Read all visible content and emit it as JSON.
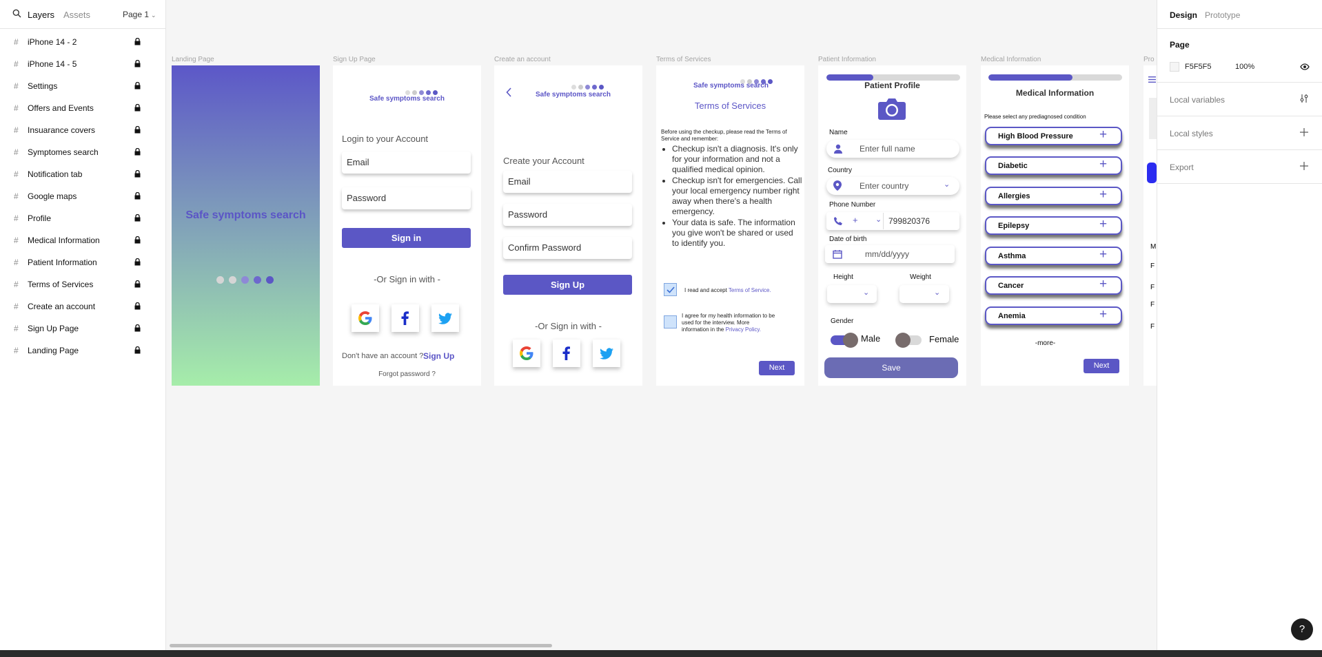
{
  "left_panel": {
    "tabs": [
      "Layers",
      "Assets"
    ],
    "page_selector": "Page 1",
    "layers": [
      "iPhone 14 - 2",
      "iPhone 14 - 5",
      "Settings",
      "Offers and Events",
      "Insuarance covers",
      "Symptomes search",
      "Notification tab",
      "Google maps",
      "Profile",
      "Medical Information",
      "Patient Information",
      "Terms of Services",
      "Create an account",
      "Sign Up Page",
      "Landing Page"
    ]
  },
  "right_panel": {
    "tabs": [
      "Design",
      "Prototype"
    ],
    "page_title": "Page",
    "page_color": "F5F5F5",
    "page_opacity": "100%",
    "local_variables": "Local variables",
    "local_styles": "Local styles",
    "export": "Export",
    "help": "?"
  },
  "canvas": {
    "frame_labels": [
      "Landing Page",
      "Sign Up Page",
      "Create an account",
      "Terms of Services",
      "Patient Information",
      "Medical Information",
      "Pro"
    ],
    "brand": "Safe symptoms search",
    "landing": {
      "title": "Safe symptoms search"
    },
    "signup": {
      "heading": "Login to your Account",
      "email": "Email",
      "password": "Password",
      "sign_in": "Sign in",
      "or_sign_in": "-Or Sign in with -",
      "no_account": "Don't have an account ?",
      "sign_up_link": "Sign Up",
      "forgot": "Forgot password ?"
    },
    "create": {
      "heading": "Create your Account",
      "email": "Email",
      "password": "Password",
      "confirm": "Confirm Password",
      "sign_up": "Sign Up",
      "or_sign_in": "-Or Sign in with -"
    },
    "terms": {
      "title": "Terms of Services",
      "intro": "Before using the checkup, please read the Terms of Service and remember:",
      "items": [
        "Checkup isn't a diagnosis. It's only for your information and not a qualified medical opinion.",
        "Checkup isn't for emergencies. Call your local emergency number right away when there's a health emergency.",
        "Your data is safe. The information you give won't be shared or used to identify you."
      ],
      "accept_text": "I read and accept",
      "accept_link": "Terms of Service.",
      "agree_text": "I agree for my health information to be used for the interview. More information in the",
      "agree_link": "Privacy Policy.",
      "next": "Next"
    },
    "patient": {
      "title": "Patient Profile",
      "progress": 0.35,
      "name_label": "Name",
      "name_placeholder": "Enter full name",
      "country_label": "Country",
      "country_placeholder": "Enter country",
      "phone_label": "Phone Number",
      "phone_prefix": "+",
      "phone_value": "799820376",
      "dob_label": "Date of birth",
      "dob_placeholder": "mm/dd/yyyy",
      "height_label": "Height",
      "weight_label": "Weight",
      "gender_label": "Gender",
      "male": "Male",
      "female": "Female",
      "save": "Save"
    },
    "medical": {
      "title": "Medical Information",
      "progress": 0.63,
      "instruction": "Please select any prediagnosed condition",
      "conditions": [
        "High Blood Pressure",
        "Diabetic",
        "Allergies",
        "Epilepsy",
        "Asthma",
        "Cancer",
        "Anemia"
      ],
      "more": "-more-",
      "next": "Next"
    },
    "profile_partial": {
      "letters": [
        "M",
        "F",
        "F",
        "F",
        "F"
      ]
    }
  },
  "colors": {
    "accent": "#5b57c5",
    "gradient_top": "#5c57c8",
    "gradient_bottom": "#a6edaa"
  }
}
